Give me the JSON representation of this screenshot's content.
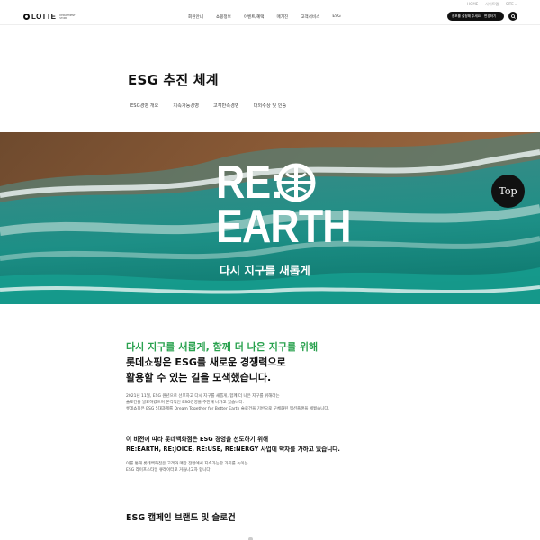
{
  "util_links": [
    "HOME",
    "사이트맵",
    "SITE ▾"
  ],
  "header": {
    "logo_text": "LOTTE",
    "logo_sub": "DEPARTMENT STORE",
    "nav": [
      "회원안내",
      "쇼핑정보",
      "이벤트/혜택",
      "매거진",
      "고객서비스",
      "ESG"
    ],
    "pill_label": "점포를 설정해 주세요",
    "pill_link": "변경하기"
  },
  "page": {
    "title": "ESG 추진 체계",
    "tabs": [
      "ESG경영 개요",
      "지속가능경영",
      "고객만족경영",
      "대외수상 및 인증"
    ]
  },
  "hero": {
    "line1": "RE:",
    "line2": "EARTH",
    "tagline": "다시 지구를 새롭게"
  },
  "top_button": "Top",
  "body": {
    "headline_green": "다시 지구를 새롭게, 함께 더 나은 지구를 위해",
    "headline1": "롯데쇼핑은 ESG를 새로운 경쟁력으로",
    "headline2": "활용할 수 있는 길을 모색했습니다.",
    "para_lines": [
      "2021년 11월, ESG 원년으로 선포하고 다시 지구를 새롭게, 함께 더 나은 지구를 위해라는",
      "슬로건을 발표하였으며 본격적인 ESG경영을 추진해 나가고 있습니다.",
      "롯데쇼핑은 ESG 5대과제를 Dream Together for Better Earth 슬로건을 기반으로 구체화된 액션플랜을 세웠습니다."
    ],
    "bold1": "이 비전에 따라 롯데백화점은 ESG 경영을 선도하기 위해",
    "bold2": "RE:EARTH, RE:JOICE, RE:USE, RE:NERGY 사업에 박차를 가하고 있습니다.",
    "para2_lines": [
      "이를 통해 롯데백화점은 고객과 매장 전반에서 지속가능한 가치를 녹이는",
      "ESG 라이프스타일 큐레이터로 거듭나고자 합니다"
    ],
    "section2_title": "ESG 캠페인 브랜드 및 슬로건"
  }
}
